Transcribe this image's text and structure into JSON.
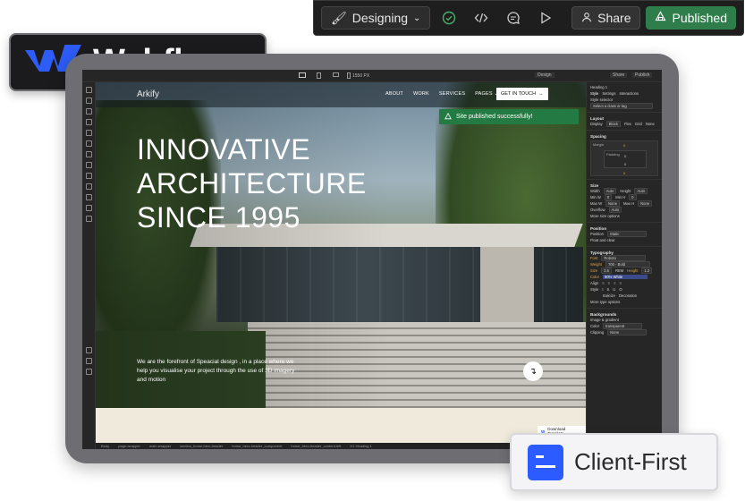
{
  "toolbar": {
    "mode_label": "Designing",
    "share_label": "Share",
    "published_label": "Published"
  },
  "badges": {
    "webflow": "Webflow",
    "client_first": "Client-First"
  },
  "designer": {
    "top": {
      "width_label": "1550 PX",
      "design_label": "Design",
      "share_label": "Share",
      "publish_label": "Publish"
    },
    "breadcrumb": [
      "Body",
      "page-wrapper",
      "main-wrapper",
      "section_home-hero-header",
      "home_hero-header_component",
      "home_hero-header_content-left",
      "H1 Heading 1"
    ],
    "panel": {
      "element": "Heading 1",
      "tabs": [
        "Style",
        "Settings",
        "Interactions"
      ],
      "selector_label": "Style selector",
      "selector_placeholder": "Select a class or tag",
      "layout": {
        "title": "Layout",
        "display_label": "Display",
        "options": [
          "Block",
          "Flex",
          "Grid",
          "None"
        ]
      },
      "spacing": {
        "title": "Spacing",
        "margin": "Margin",
        "padding": "Padding",
        "zero": "0"
      },
      "size": {
        "title": "Size",
        "width": "Width",
        "height": "Height",
        "auto": "Auto",
        "min_w": "Min W",
        "min_h": "Min H",
        "max_w": "Max W",
        "max_h": "Max H",
        "none": "None",
        "overflow": "Overflow",
        "more": "More size options"
      },
      "position": {
        "title": "Position",
        "label": "Position",
        "value": "Static",
        "float": "Float and clear"
      },
      "typography": {
        "title": "Typography",
        "font_label": "Font",
        "font_value": "Roboto",
        "weight_label": "Weight",
        "weight_value": "700 - Bold",
        "size_label": "Size",
        "size_value": "3.5",
        "size_unit": "REM",
        "height_label": "Height",
        "height_value": "1.2",
        "color_label": "Color",
        "color_value": "90% White",
        "align_label": "Align",
        "style_label": "Style",
        "italicize": "Italicize",
        "decoration": "Decoration",
        "more": "More type options"
      },
      "backgrounds": {
        "title": "Backgrounds",
        "image_label": "Image & gradient",
        "color_label": "Color",
        "color_value": "transparent",
        "clipping_label": "Clipping",
        "clipping_value": "None"
      }
    }
  },
  "site": {
    "logo": "Arkify",
    "nav": [
      "ABOUT",
      "WORK",
      "SERVICES",
      "PAGES"
    ],
    "cta": "GET IN TOUCH",
    "toast": "Site published successfully!",
    "hero_lines": [
      "INNOVATIVE",
      "ARCHITECTURE",
      "SINCE 1995"
    ],
    "hero_copy": "We are the forefront of Speacial design , in a place where we help you visualise your project through the use of 3D imagery and motion",
    "download_template": "Download Template"
  },
  "colors": {
    "published_green": "#2e7d4a",
    "toast_green": "#237a42",
    "client_first_blue": "#2c5cff"
  }
}
